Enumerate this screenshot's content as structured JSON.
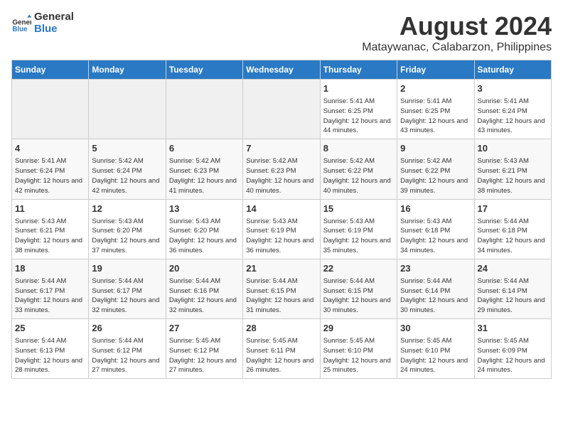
{
  "header": {
    "logo_general": "General",
    "logo_blue": "Blue",
    "month_year": "August 2024",
    "location": "Mataywanac, Calabarzon, Philippines"
  },
  "days_of_week": [
    "Sunday",
    "Monday",
    "Tuesday",
    "Wednesday",
    "Thursday",
    "Friday",
    "Saturday"
  ],
  "weeks": [
    [
      {
        "day": "",
        "empty": true
      },
      {
        "day": "",
        "empty": true
      },
      {
        "day": "",
        "empty": true
      },
      {
        "day": "",
        "empty": true
      },
      {
        "day": "1",
        "sunrise": "5:41 AM",
        "sunset": "6:25 PM",
        "daylight": "12 hours and 44 minutes."
      },
      {
        "day": "2",
        "sunrise": "5:41 AM",
        "sunset": "6:25 PM",
        "daylight": "12 hours and 43 minutes."
      },
      {
        "day": "3",
        "sunrise": "5:41 AM",
        "sunset": "6:24 PM",
        "daylight": "12 hours and 43 minutes."
      }
    ],
    [
      {
        "day": "4",
        "sunrise": "5:41 AM",
        "sunset": "6:24 PM",
        "daylight": "12 hours and 42 minutes."
      },
      {
        "day": "5",
        "sunrise": "5:42 AM",
        "sunset": "6:24 PM",
        "daylight": "12 hours and 42 minutes."
      },
      {
        "day": "6",
        "sunrise": "5:42 AM",
        "sunset": "6:23 PM",
        "daylight": "12 hours and 41 minutes."
      },
      {
        "day": "7",
        "sunrise": "5:42 AM",
        "sunset": "6:23 PM",
        "daylight": "12 hours and 40 minutes."
      },
      {
        "day": "8",
        "sunrise": "5:42 AM",
        "sunset": "6:22 PM",
        "daylight": "12 hours and 40 minutes."
      },
      {
        "day": "9",
        "sunrise": "5:42 AM",
        "sunset": "6:22 PM",
        "daylight": "12 hours and 39 minutes."
      },
      {
        "day": "10",
        "sunrise": "5:43 AM",
        "sunset": "6:21 PM",
        "daylight": "12 hours and 38 minutes."
      }
    ],
    [
      {
        "day": "11",
        "sunrise": "5:43 AM",
        "sunset": "6:21 PM",
        "daylight": "12 hours and 38 minutes."
      },
      {
        "day": "12",
        "sunrise": "5:43 AM",
        "sunset": "6:20 PM",
        "daylight": "12 hours and 37 minutes."
      },
      {
        "day": "13",
        "sunrise": "5:43 AM",
        "sunset": "6:20 PM",
        "daylight": "12 hours and 36 minutes."
      },
      {
        "day": "14",
        "sunrise": "5:43 AM",
        "sunset": "6:19 PM",
        "daylight": "12 hours and 36 minutes."
      },
      {
        "day": "15",
        "sunrise": "5:43 AM",
        "sunset": "6:19 PM",
        "daylight": "12 hours and 35 minutes."
      },
      {
        "day": "16",
        "sunrise": "5:43 AM",
        "sunset": "6:18 PM",
        "daylight": "12 hours and 34 minutes."
      },
      {
        "day": "17",
        "sunrise": "5:44 AM",
        "sunset": "6:18 PM",
        "daylight": "12 hours and 34 minutes."
      }
    ],
    [
      {
        "day": "18",
        "sunrise": "5:44 AM",
        "sunset": "6:17 PM",
        "daylight": "12 hours and 33 minutes."
      },
      {
        "day": "19",
        "sunrise": "5:44 AM",
        "sunset": "6:17 PM",
        "daylight": "12 hours and 32 minutes."
      },
      {
        "day": "20",
        "sunrise": "5:44 AM",
        "sunset": "6:16 PM",
        "daylight": "12 hours and 32 minutes."
      },
      {
        "day": "21",
        "sunrise": "5:44 AM",
        "sunset": "6:15 PM",
        "daylight": "12 hours and 31 minutes."
      },
      {
        "day": "22",
        "sunrise": "5:44 AM",
        "sunset": "6:15 PM",
        "daylight": "12 hours and 30 minutes."
      },
      {
        "day": "23",
        "sunrise": "5:44 AM",
        "sunset": "6:14 PM",
        "daylight": "12 hours and 30 minutes."
      },
      {
        "day": "24",
        "sunrise": "5:44 AM",
        "sunset": "6:14 PM",
        "daylight": "12 hours and 29 minutes."
      }
    ],
    [
      {
        "day": "25",
        "sunrise": "5:44 AM",
        "sunset": "6:13 PM",
        "daylight": "12 hours and 28 minutes."
      },
      {
        "day": "26",
        "sunrise": "5:44 AM",
        "sunset": "6:12 PM",
        "daylight": "12 hours and 27 minutes."
      },
      {
        "day": "27",
        "sunrise": "5:45 AM",
        "sunset": "6:12 PM",
        "daylight": "12 hours and 27 minutes."
      },
      {
        "day": "28",
        "sunrise": "5:45 AM",
        "sunset": "6:11 PM",
        "daylight": "12 hours and 26 minutes."
      },
      {
        "day": "29",
        "sunrise": "5:45 AM",
        "sunset": "6:10 PM",
        "daylight": "12 hours and 25 minutes."
      },
      {
        "day": "30",
        "sunrise": "5:45 AM",
        "sunset": "6:10 PM",
        "daylight": "12 hours and 24 minutes."
      },
      {
        "day": "31",
        "sunrise": "5:45 AM",
        "sunset": "6:09 PM",
        "daylight": "12 hours and 24 minutes."
      }
    ]
  ]
}
